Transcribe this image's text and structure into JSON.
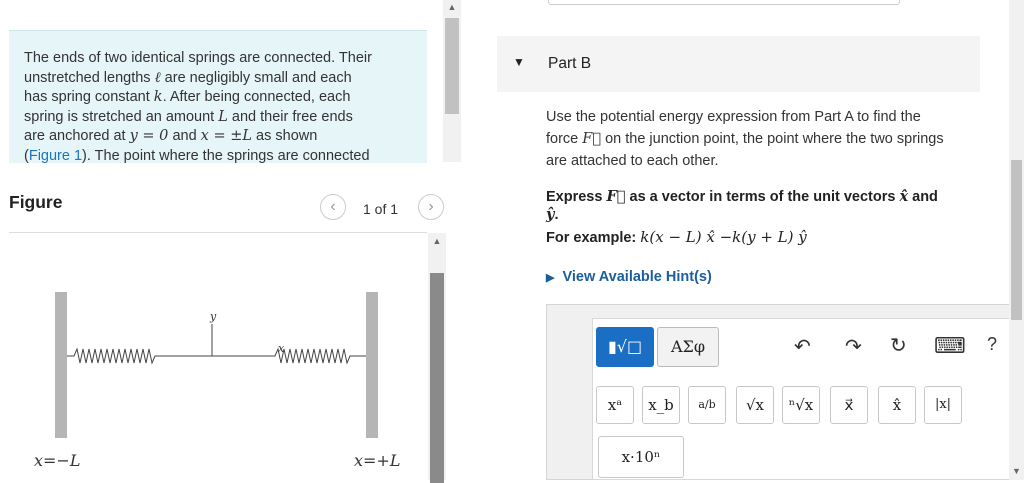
{
  "problem": {
    "line1": "The ends of two identical springs are connected. Their",
    "line2_a": "unstretched lengths",
    "line2_ell": "ℓ",
    "line2_b": "are negligibly small and each",
    "line3_a": "has spring constant",
    "line3_k": "k",
    "line3_b": ". After being connected, each",
    "line4_a": "spring is stretched an amount",
    "line4_L": "L",
    "line4_b": "and their free ends",
    "line5_a": "are anchored at",
    "line5_m1": "y = 0",
    "line5_b": "and",
    "line5_m2": "x = ±L",
    "line5_c": "as shown",
    "line6_open": "(",
    "line6_link": "Figure 1",
    "line6_b": "). The point where the springs are connected"
  },
  "figure": {
    "heading": "Figure",
    "page_indicator": "1 of 1",
    "prev_icon": "chevron-left-icon",
    "next_icon": "chevron-right-icon",
    "label_left": "x=−L",
    "label_right": "x=+L",
    "label_x": "x",
    "label_y": "y"
  },
  "part": {
    "caret": "▼",
    "title": "Part B",
    "instruction_a": "Use the potential energy expression from Part A to find the",
    "instruction_b1": "force",
    "instruction_F": "F⃗",
    "instruction_b2": "on the junction point, the point where the two springs",
    "instruction_c": "are attached to each other.",
    "express_a": "Express",
    "express_F": "F⃗",
    "express_b": "as a vector in terms of the unit vectors",
    "express_xhat": "x̂",
    "express_and": "and",
    "express_yhat": "ŷ",
    "express_dot": ".",
    "example_label": "For example:",
    "example_math": "k(x − L) x̂ −k(y + L) ŷ",
    "hint_label": "View Available Hint(s)"
  },
  "editor": {
    "mode_templates": "▮√□",
    "mode_symbols": "ΑΣφ",
    "undo": "↶",
    "redo": "↷",
    "reset": "↻",
    "keyboard": "⌨",
    "help": "?",
    "tools": [
      "xᵃ",
      "x_b",
      "a/b",
      "√x",
      "ⁿ√x",
      "x⃗",
      "x̂",
      "|x|"
    ],
    "sci": "x·10ⁿ"
  },
  "colors": {
    "problem_bg": "#e6f5f7",
    "link": "#1b75bb",
    "hint": "#1b5f9a",
    "mode_active": "#1a6fc4"
  }
}
